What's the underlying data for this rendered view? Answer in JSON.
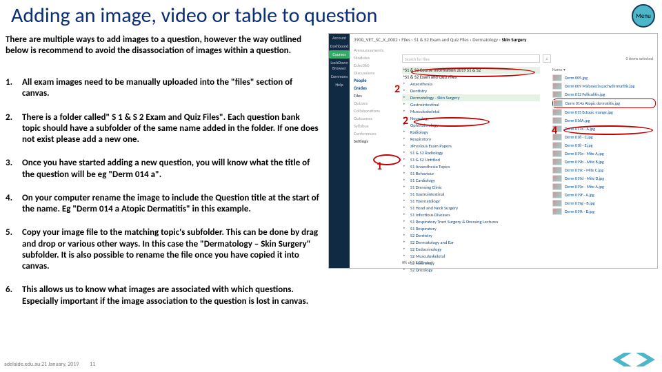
{
  "title": "Adding an image, video or table to question",
  "menu_label": "Menu",
  "intro": "There are multiple ways to add images to a question, however the way outlined below is recommend to avoid the disassociation of images within a question.",
  "steps": [
    "All exam images need to be manually uploaded into the \"files\" section of canvas.",
    "There is a folder  called\" S 1 & S 2 Exam and Quiz Files\". Each question bank topic should have a subfolder of the same name added in the folder. If one does not exist please add a new one.",
    "Once you have started adding a new question, you will know what the title of the question will be eg \"Derm 014 a\".",
    "On your computer rename the image to include the Question title at the start of the name. Eg \"Derm 014 a Atopic Dermatitis\" in this example.",
    "Copy your image file to the matching topic's subfolder. This can be done by drag and drop or various other ways. In this case the \"Dermatology – Skin Surgery\" subfolder. It is also possible to rename the file once you have copied it into canvas.",
    "This allows us to know what images are associated with which questions. Especially important if the image association to the question is lost in canvas."
  ],
  "footer": {
    "site": "adelaide.edu.au",
    "date": "21 January, 2019",
    "page": "11"
  },
  "callouts": {
    "c1": "1",
    "c2a": "2",
    "c2b": "2",
    "c4": "4"
  },
  "shot": {
    "crumb_course": "3900_VET_SC_X_0002",
    "crumb_files": "Files",
    "crumb_folder": "S1 & S2 Exam and Quiz Files",
    "crumb_sub": "Dermatology",
    "crumb_leaf": "Skin Surgery",
    "search_placeholder": "Search for files",
    "sel_count": "0 items selected",
    "announcements": "Announcements",
    "braille": [
      "Account",
      "Dashboard",
      "Courses",
      "LockDown Browser",
      "Commons",
      "Help"
    ],
    "leftnav": [
      {
        "t": "Announcements"
      },
      {
        "t": "Modules"
      },
      {
        "t": "Echo360"
      },
      {
        "t": "Discussions"
      },
      {
        "t": "People",
        "on": true
      },
      {
        "t": "Grades",
        "on": true
      },
      {
        "t": "Files",
        "blk": true
      },
      {
        "t": "Quizzes"
      },
      {
        "t": "Collaborations"
      },
      {
        "t": "Outcomes"
      },
      {
        "t": "Syllabus"
      },
      {
        "t": "Conferences"
      },
      {
        "t": "Settings",
        "blk": true
      }
    ],
    "tree": [
      {
        "t": "S1 & S2 Course Information 2019 S1 & S2",
        "lvl": 1,
        "hl": true
      },
      {
        "t": "S1 & S2 Exam and Quiz Files",
        "lvl": 1
      },
      {
        "t": "Anaesthesia"
      },
      {
        "t": "Dentistry"
      },
      {
        "t": "Dermatology - Skin Surgery",
        "hl": true
      },
      {
        "t": "Gastrointestinal"
      },
      {
        "t": "Musculoskeletal"
      },
      {
        "t": "Neurology"
      },
      {
        "t": "Ophthalmology"
      },
      {
        "t": "Radiology"
      },
      {
        "t": "Respiratory"
      },
      {
        "t": "zPrevious Exam Papers"
      },
      {
        "t": "S1 & S2 Radiology"
      },
      {
        "t": "S1 & S2 Untitled"
      },
      {
        "t": "S1 Anaesthesia Topics"
      },
      {
        "t": "S1 Behaviour"
      },
      {
        "t": "S1 Cardiology"
      },
      {
        "t": "S1 Dressing Clinic"
      },
      {
        "t": "S1 Gastrointestinal"
      },
      {
        "t": "S1 Haematology"
      },
      {
        "t": "S1 Head and Neck Surgery"
      },
      {
        "t": "S1 Infectious Diseases"
      },
      {
        "t": "S1 Respiratory Tract Surgery & Dressing Lectures"
      },
      {
        "t": "S1 Respiratory"
      },
      {
        "t": "S2 Dentistry"
      },
      {
        "t": "S2 Dermatology and Ear"
      },
      {
        "t": "S2 Endocrinology"
      },
      {
        "t": "S2 Musculoskeletal"
      },
      {
        "t": "S2 Neurology"
      },
      {
        "t": "S2 Oncology"
      }
    ],
    "files_hdr": "Name ▾",
    "files": [
      "Derm 005.jpg",
      "Derm 009 Malassezia pachydermatitis.jpg",
      "Derm 012 Folliculitis.jpg",
      "Derm 014a Atopic dermatitis.jpg",
      "Derm 015 Ectopic mange.jpg",
      "Derm 016A.jpg",
      "Derm 017a - A.jpg",
      "Derm 018 - C.jpg",
      "Derm 018 - E.jpg",
      "Derm 019a - Mite A.jpg",
      "Derm 019b - Mite B.jpg",
      "Derm 019c - Mite C.jpg",
      "Derm 019d - Mite D.jpg",
      "Derm 019e - Mite A.jpg",
      "Derm 019f - A.jpg",
      "Derm 019g - B.jpg",
      "Derm 019t - D.jpg"
    ],
    "storage": "0% of 5.2 GB used"
  }
}
